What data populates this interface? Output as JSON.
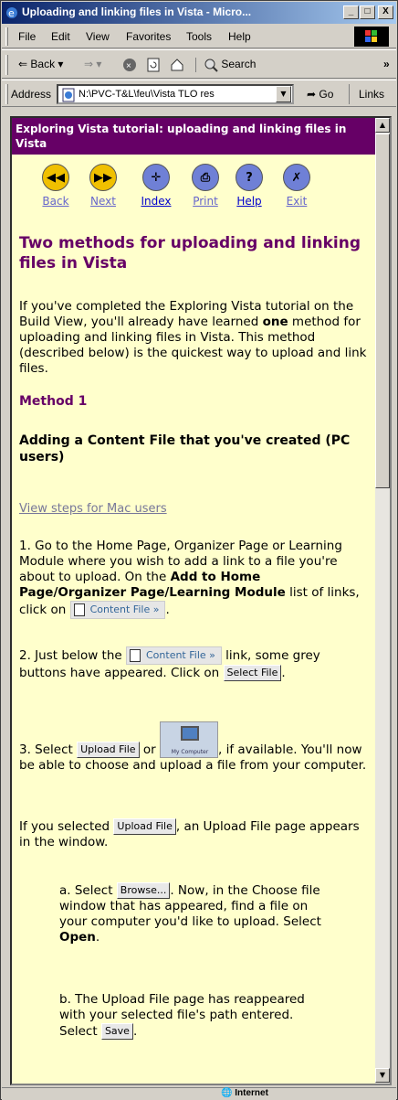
{
  "window": {
    "title": "Uploading and linking files in Vista - Micro..."
  },
  "titlebar_buttons": [
    "_",
    "□",
    "X"
  ],
  "menu": [
    "File",
    "Edit",
    "View",
    "Favorites",
    "Tools",
    "Help"
  ],
  "toolbar": {
    "back_label": "Back",
    "search_label": "Search"
  },
  "address": {
    "label": "Address",
    "value": "N:\\PVC-T&L\\feu\\Vista TLO res",
    "go_label": "Go",
    "links_label": "Links"
  },
  "page": {
    "banner": "Exploring Vista tutorial: uploading and linking files in Vista",
    "nav": [
      {
        "label": "Back",
        "glyph": "◀◀"
      },
      {
        "label": "Next",
        "glyph": "▶▶"
      },
      {
        "label": "Index",
        "glyph": "✛"
      },
      {
        "label": "Print",
        "glyph": "⎙"
      },
      {
        "label": "Help",
        "glyph": "?"
      },
      {
        "label": "Exit",
        "glyph": "✗"
      }
    ],
    "heading": "Two methods for uploading and linking files in Vista",
    "intro_a": "If you've completed the Exploring Vista tutorial on the Build View, you'll already have learned ",
    "intro_bold": "one",
    "intro_b": " method for uploading and linking files in Vista. This method (described below) is the quickest way to upload and link files.",
    "method_heading": "Method 1",
    "subheading": "Adding a Content File that you've created (PC users)",
    "mac_link": "View steps for Mac users",
    "step1_a": "1. Go to the Home Page, Organizer Page or Learning Module where you wish to add a link to a file you're about to upload. On the ",
    "step1_bold": "Add to Home Page/Organizer Page/Learning Module",
    "step1_b": " list of links, click on ",
    "step1_c": ".",
    "content_file_btn": "Content File",
    "step2_a": "2. Just below the ",
    "step2_b": " link, some grey buttons have appeared. Click on ",
    "step2_c": ".",
    "select_file_btn": "Select File",
    "step3_a": "3. Select ",
    "step3_or": " or ",
    "step3_b": ", if available. You'll now be able to choose and upload a file from your computer.",
    "upload_file_btn": "Upload File",
    "my_computer_label": "My Computer",
    "step4_a": "If you selected ",
    "step4_b": ", an Upload File page appears in the window.",
    "step_a_a": "a. Select ",
    "browse_btn": "Browse...",
    "step_a_b": ". Now, in the Choose file window that has appeared, find a file on your computer you'd like to upload. Select ",
    "step_a_bold": "Open",
    "step_a_c": ".",
    "step_b_a": "b. The Upload File page has reappeared with your selected file's path entered. Select ",
    "save_btn": "Save",
    "step_b_b": "."
  },
  "status": {
    "zone": "Internet"
  }
}
